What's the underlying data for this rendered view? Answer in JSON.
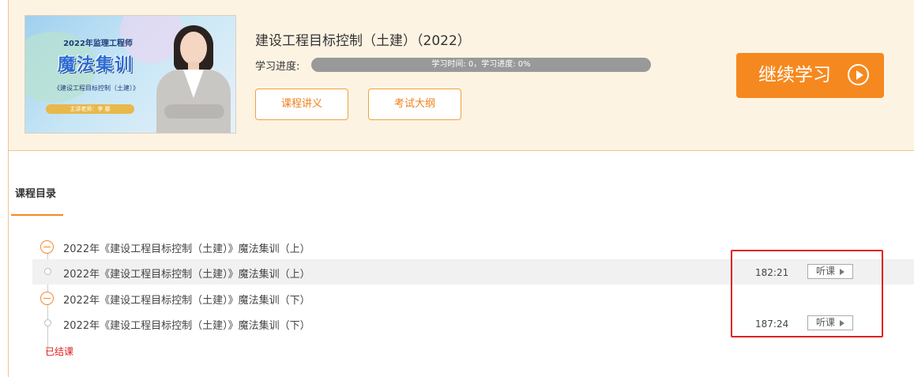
{
  "course": {
    "cover": {
      "line1": "2022年监理工程师",
      "title": "魔法集训",
      "subtitle": "《建设工程目标控制（土建）》",
      "teacher": "主讲老师：李 娜"
    },
    "title": "建设工程目标控制（土建）（2022）",
    "progress_label": "学习进度:",
    "progress_text": "学习时间: 0，学习进度: 0%",
    "progress_percent": 0,
    "notes_button": "课程讲义",
    "syllabus_button": "考试大纲",
    "continue_button": "继续学习"
  },
  "catalog": {
    "tab_label": "课程目录",
    "rows": [
      {
        "type": "chapter",
        "label": "2022年《建设工程目标控制（土建）》魔法集训（上）"
      },
      {
        "type": "lesson",
        "label": "2022年《建设工程目标控制（土建）》魔法集训（上）",
        "duration": "182:21",
        "action": "听课"
      },
      {
        "type": "chapter",
        "label": "2022年《建设工程目标控制（土建）》魔法集训（下）"
      },
      {
        "type": "lesson",
        "label": "2022年《建设工程目标控制（土建）》魔法集训（下）",
        "duration": "187:24",
        "action": "听课"
      }
    ],
    "status": "已结课"
  },
  "colors": {
    "accent": "#f5891f",
    "header_bg": "#fdf3e3",
    "annotation_red": "#e02020"
  }
}
